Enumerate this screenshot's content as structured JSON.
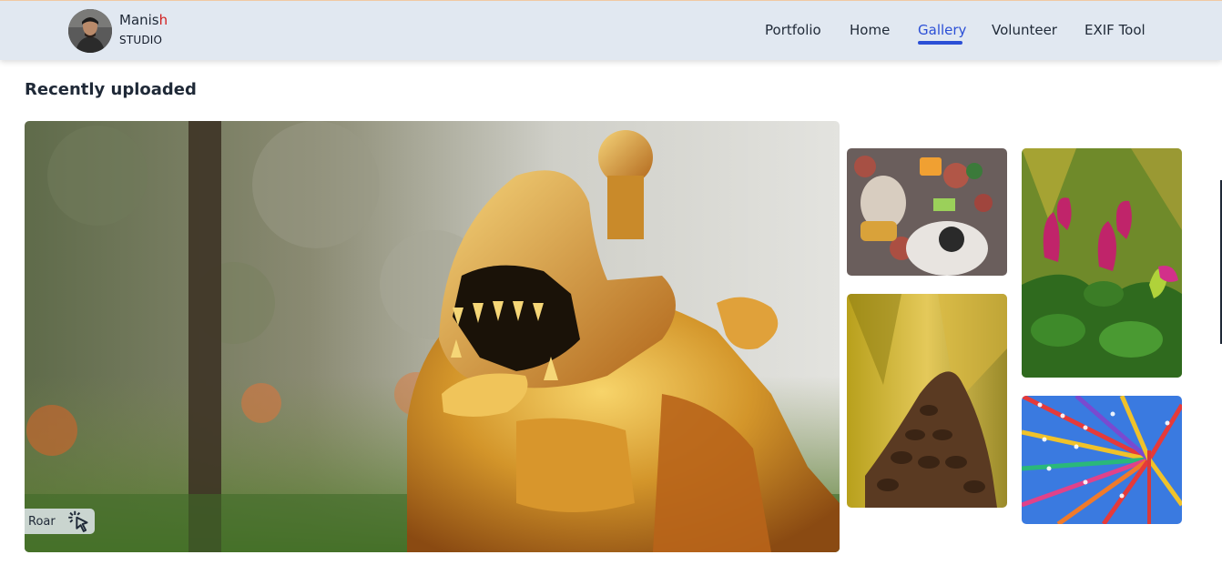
{
  "header": {
    "brand_name_main": "Manis",
    "brand_name_accent": "h",
    "brand_sub": "STUDIO",
    "nav": [
      {
        "label": "Portfolio",
        "active": false
      },
      {
        "label": "Home",
        "active": false
      },
      {
        "label": "Gallery",
        "active": true
      },
      {
        "label": "Volunteer",
        "active": false
      },
      {
        "label": "EXIF Tool",
        "active": false
      }
    ],
    "accent_color": "#2b4fd6"
  },
  "main": {
    "section_title": "Recently uploaded",
    "featured": {
      "caption": "Roar",
      "caption_icon": "cursor-click-icon"
    }
  }
}
